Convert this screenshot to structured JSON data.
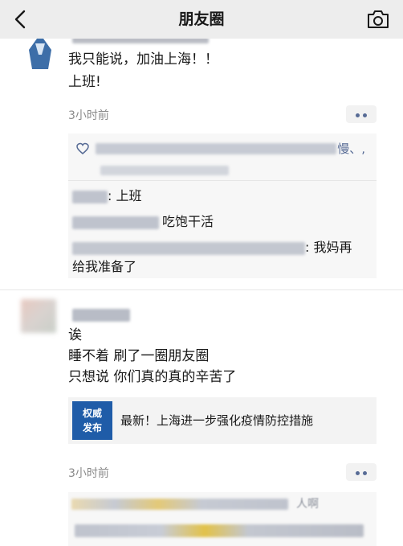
{
  "nav": {
    "title": "朋友圈",
    "back_icon": "chevron-left-icon",
    "camera_icon": "camera-icon"
  },
  "post1": {
    "text_lines": [
      "我只能说，加油上海！！",
      "上班!"
    ],
    "time": "3小时前",
    "likes_tail": "慢、,",
    "comments": [
      {
        "text": ": 上班"
      },
      {
        "text": "吃饱干活"
      },
      {
        "text": ": 我妈再"
      },
      {
        "text": "给我准备了"
      }
    ]
  },
  "post2": {
    "text_lines": [
      "诶",
      "睡不着 刷了一圈朋友圈",
      "只想说 你们真的真的辛苦了"
    ],
    "link_card": {
      "thumb_line1": "权威",
      "thumb_line2": "发布",
      "title": "最新！上海进一步强化疫情防控措施"
    },
    "time": "3小时前",
    "comment_partial": "人啊"
  },
  "colors": {
    "nav_bg": "#ededed",
    "link_blue": "#576b95",
    "comment_bg": "#f7f7f7",
    "thumb_blue": "#1f5ca8"
  }
}
